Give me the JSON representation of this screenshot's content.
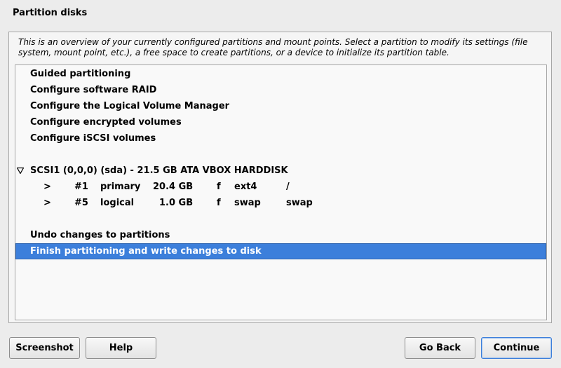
{
  "window": {
    "title": "Partition disks"
  },
  "description": "This is an overview of your currently configured partitions and mount points. Select a partition to modify its settings (file system, mount point, etc.), a free space to create partitions, or a device to initialize its partition table.",
  "menu_items": [
    "Guided partitioning",
    "Configure software RAID",
    "Configure the Logical Volume Manager",
    "Configure encrypted volumes",
    "Configure iSCSI volumes"
  ],
  "disk": {
    "label": "SCSI1 (0,0,0) (sda) - 21.5 GB ATA VBOX HARDDISK",
    "partitions": [
      {
        "arrow": ">",
        "number": "#1",
        "type": "primary",
        "size": "20.4 GB",
        "flag": "f",
        "fs": "ext4",
        "mount": "/"
      },
      {
        "arrow": ">",
        "number": "#5",
        "type": "logical",
        "size": "1.0 GB",
        "flag": "f",
        "fs": "swap",
        "mount": "swap"
      }
    ]
  },
  "actions": {
    "undo": "Undo changes to partitions",
    "finish": "Finish partitioning and write changes to disk"
  },
  "buttons": {
    "screenshot": "Screenshot",
    "help": "Help",
    "go_back": "Go Back",
    "continue": "Continue"
  },
  "colors": {
    "selection": "#3c7fdb",
    "background": "#ececec"
  }
}
